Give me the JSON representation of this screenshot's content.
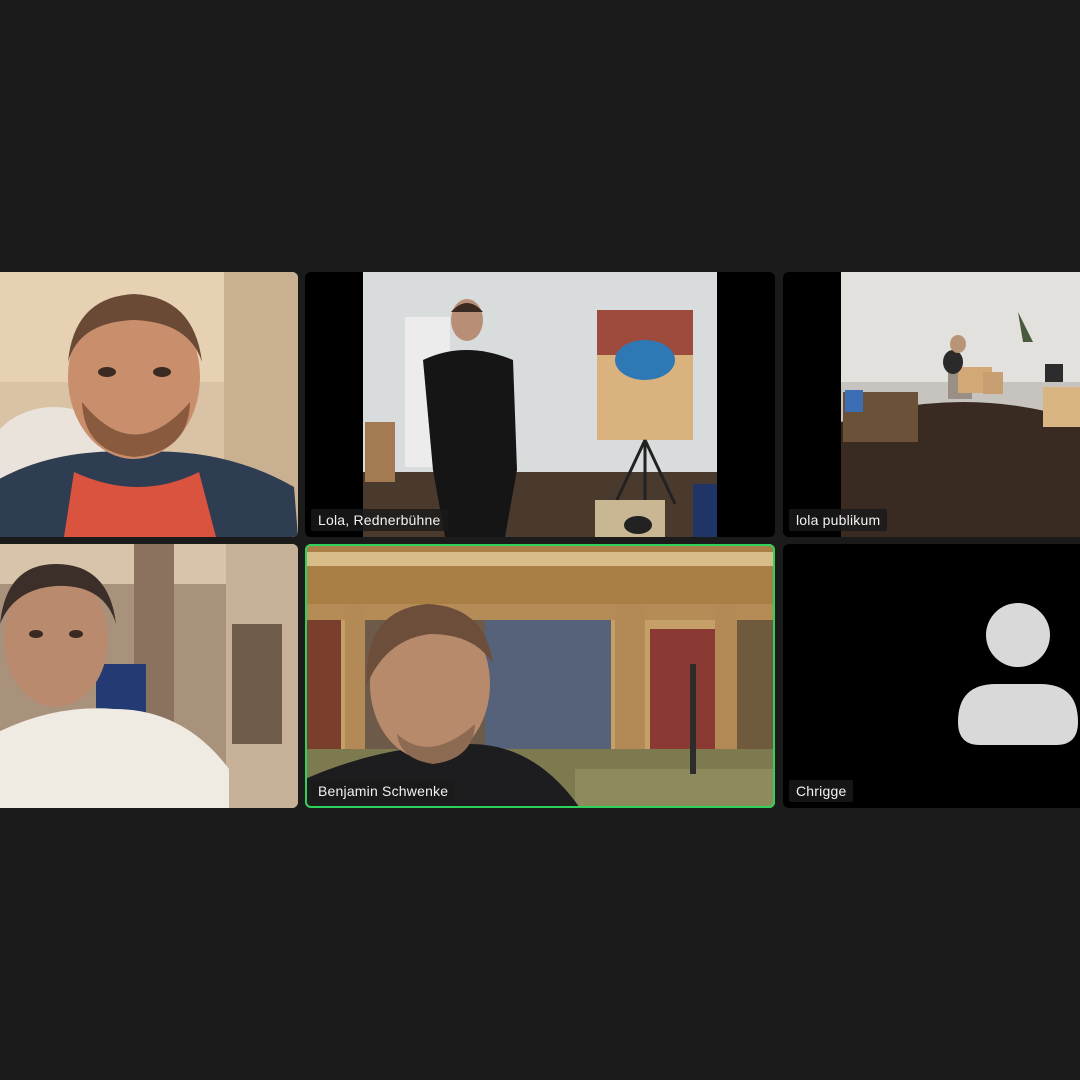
{
  "participants": [
    {
      "name": "",
      "video": "camera-on"
    },
    {
      "name": "Lola, Rednerbühne",
      "video": "camera-on"
    },
    {
      "name": "lola publikum",
      "video": "camera-on"
    },
    {
      "name": "",
      "video": "camera-on"
    },
    {
      "name": "Benjamin Schwenke",
      "video": "camera-on",
      "active_speaker": true
    },
    {
      "name": "Chrigge",
      "video": "camera-off",
      "icon": "user-avatar-icon"
    }
  ],
  "colors": {
    "background": "#1b1b1b",
    "active_speaker_border": "#2fd15b",
    "avatar": "#d9d9d9"
  }
}
